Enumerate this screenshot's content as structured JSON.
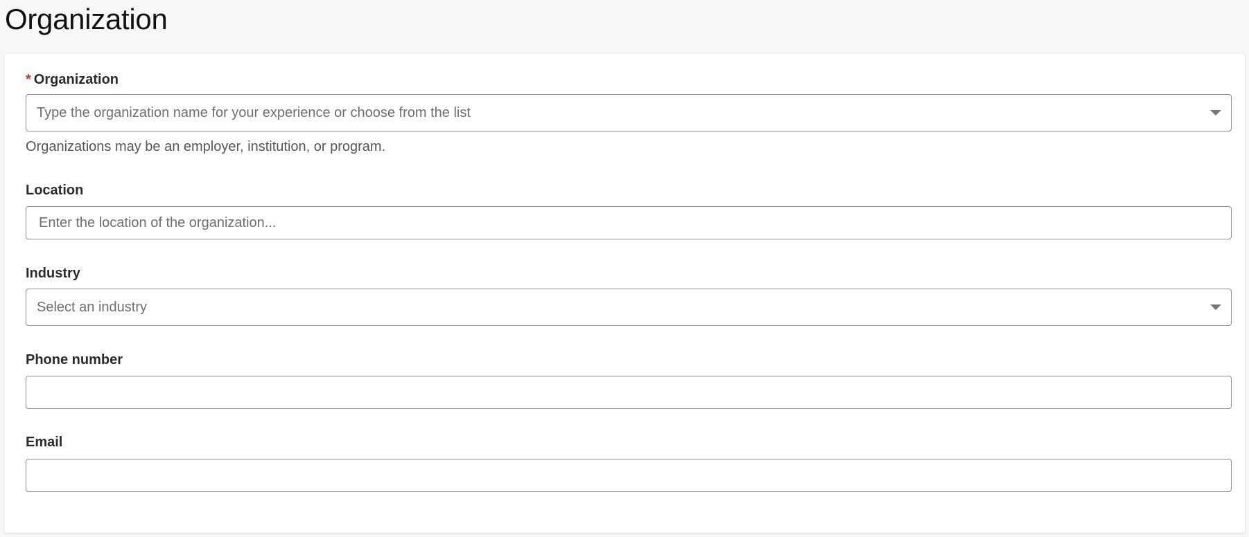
{
  "page": {
    "title": "Organization"
  },
  "form": {
    "organization": {
      "required_mark": "*",
      "label": "Organization",
      "placeholder": "Type the organization name for your experience or choose from the list",
      "value": "",
      "help": "Organizations may be an employer, institution, or program.",
      "icon": "chevron-down-icon"
    },
    "location": {
      "label": "Location",
      "placeholder": "Enter the location of the organization...",
      "value": ""
    },
    "industry": {
      "label": "Industry",
      "selected": "Select an industry",
      "icon": "chevron-down-icon"
    },
    "phone": {
      "label": "Phone number",
      "value": ""
    },
    "email": {
      "label": "Email",
      "value": ""
    }
  },
  "colors": {
    "required": "#d0342c",
    "border": "#8c8c8c",
    "background": "#f7f7f7",
    "card": "#ffffff"
  }
}
